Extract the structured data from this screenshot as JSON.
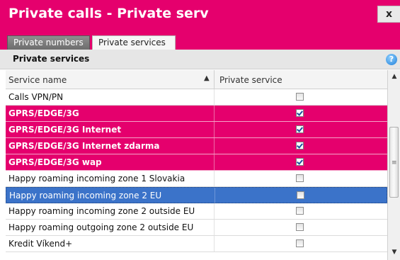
{
  "window": {
    "title": "Private calls - Private serv",
    "close_label": "x"
  },
  "tabs": [
    {
      "label": "Private numbers",
      "active": false
    },
    {
      "label": "Private services",
      "active": true
    }
  ],
  "panel": {
    "title": "Private services",
    "help_label": "?"
  },
  "table": {
    "columns": [
      "Service name",
      "Private service"
    ],
    "sort": {
      "column": "Service name",
      "direction": "ascending"
    },
    "rows": [
      {
        "name": "Calls VPN/PN",
        "checked": false,
        "highlight": "none"
      },
      {
        "name": "GPRS/EDGE/3G",
        "checked": true,
        "highlight": "pink"
      },
      {
        "name": "GPRS/EDGE/3G Internet",
        "checked": true,
        "highlight": "pink"
      },
      {
        "name": "GPRS/EDGE/3G Internet zdarma",
        "checked": true,
        "highlight": "pink"
      },
      {
        "name": "GPRS/EDGE/3G wap",
        "checked": true,
        "highlight": "pink"
      },
      {
        "name": "Happy roaming incoming zone 1 Slovakia",
        "checked": false,
        "highlight": "none"
      },
      {
        "name": "Happy roaming incoming zone 2 EU",
        "checked": false,
        "highlight": "selected"
      },
      {
        "name": "Happy roaming incoming zone 2 outside EU",
        "checked": false,
        "highlight": "none"
      },
      {
        "name": "Happy roaming outgoing zone 2 outside EU",
        "checked": false,
        "highlight": "none"
      },
      {
        "name": "Kredit Víkend+",
        "checked": false,
        "highlight": "none"
      }
    ]
  },
  "colors": {
    "brand_magenta": "#e5006d",
    "selection_blue": "#3b73c9",
    "header_gray": "#e6e6e6"
  },
  "icons": {
    "sort": "triangle-up-icon",
    "help": "question-circle-icon",
    "close": "close-icon"
  }
}
